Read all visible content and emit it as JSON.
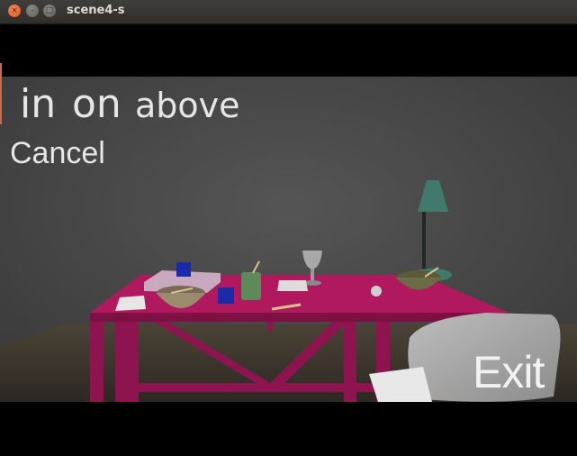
{
  "window": {
    "title": "scene4-s",
    "close_glyph": "×",
    "min_glyph": "–",
    "max_glyph": "□"
  },
  "overlay": {
    "options": [
      "in",
      "on",
      "above"
    ],
    "cancel_label": "Cancel",
    "exit_label": "Exit"
  },
  "colors": {
    "wall": "#4a4a4a",
    "floor": "#3a342a",
    "table": "#b0195e",
    "table_dark": "#7d1043",
    "text": "#e6e6e6"
  },
  "icons": [
    "close-icon",
    "minimize-icon",
    "maximize-icon"
  ]
}
